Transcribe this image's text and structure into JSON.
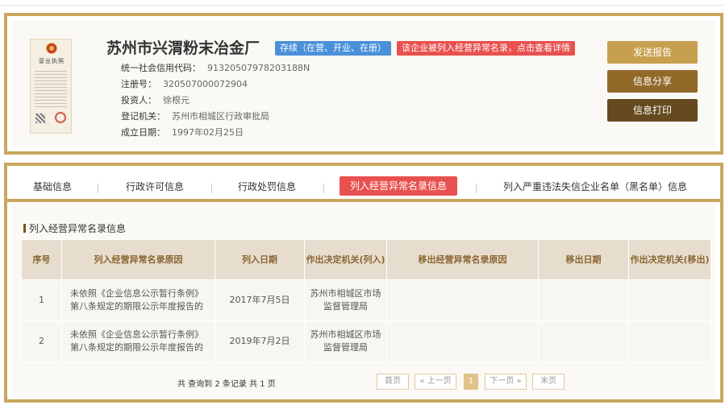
{
  "company": {
    "name": "苏州市兴渭粉末冶金厂",
    "status_badge": "存续（在营、开业、在册）",
    "warning_badge": "该企业被列入经营异常名录，点击查看详情",
    "license_title": "营业执照",
    "fields": [
      {
        "label": "统一社会信用代码：",
        "value": "91320507978203188N"
      },
      {
        "label": "注册号：",
        "value": "320507000072904"
      },
      {
        "label": "投资人：",
        "value": "徐根元"
      },
      {
        "label": "登记机关：",
        "value": "苏州市相城区行政审批局"
      },
      {
        "label": "成立日期：",
        "value": "1997年02月25日"
      }
    ]
  },
  "actions": {
    "report": "发送报告",
    "share": "信息分享",
    "print": "信息打印"
  },
  "tabs": [
    {
      "label": "基础信息"
    },
    {
      "label": "行政许可信息"
    },
    {
      "label": "行政处罚信息"
    },
    {
      "label": "列入经营异常名录信息"
    },
    {
      "label": "列入严重违法失信企业名单（黑名单）信息"
    }
  ],
  "active_tab": 3,
  "section": {
    "title": "列入经营异常名录信息"
  },
  "table": {
    "headers": [
      "序号",
      "列入经营异常名录原因",
      "列入日期",
      "作出决定机关(列入)",
      "移出经营异常名录原因",
      "移出日期",
      "作出决定机关(移出)"
    ],
    "rows": [
      [
        "1",
        "未依照《企业信息公示暂行条例》第八条规定的期限公示年度报告的",
        "2017年7月5日",
        "苏州市相城区市场监督管理局",
        "",
        "",
        ""
      ],
      [
        "2",
        "未依照《企业信息公示暂行条例》第八条规定的期限公示年度报告的",
        "2019年7月2日",
        "苏州市相城区市场监督管理局",
        "",
        "",
        ""
      ]
    ]
  },
  "pager": {
    "summary": "共 查询到 2 条记录 共 1 页",
    "first": "首页",
    "prev": "« 上一页",
    "current": "1",
    "next": "下一页 »",
    "last": "末页"
  },
  "colors": {
    "gold_border": "#c9a75e",
    "badge_blue": "#4a90d9",
    "badge_red": "#e8514f",
    "btn_report": "#c7a04f",
    "btn_share": "#93692a",
    "btn_print": "#654a1f"
  }
}
